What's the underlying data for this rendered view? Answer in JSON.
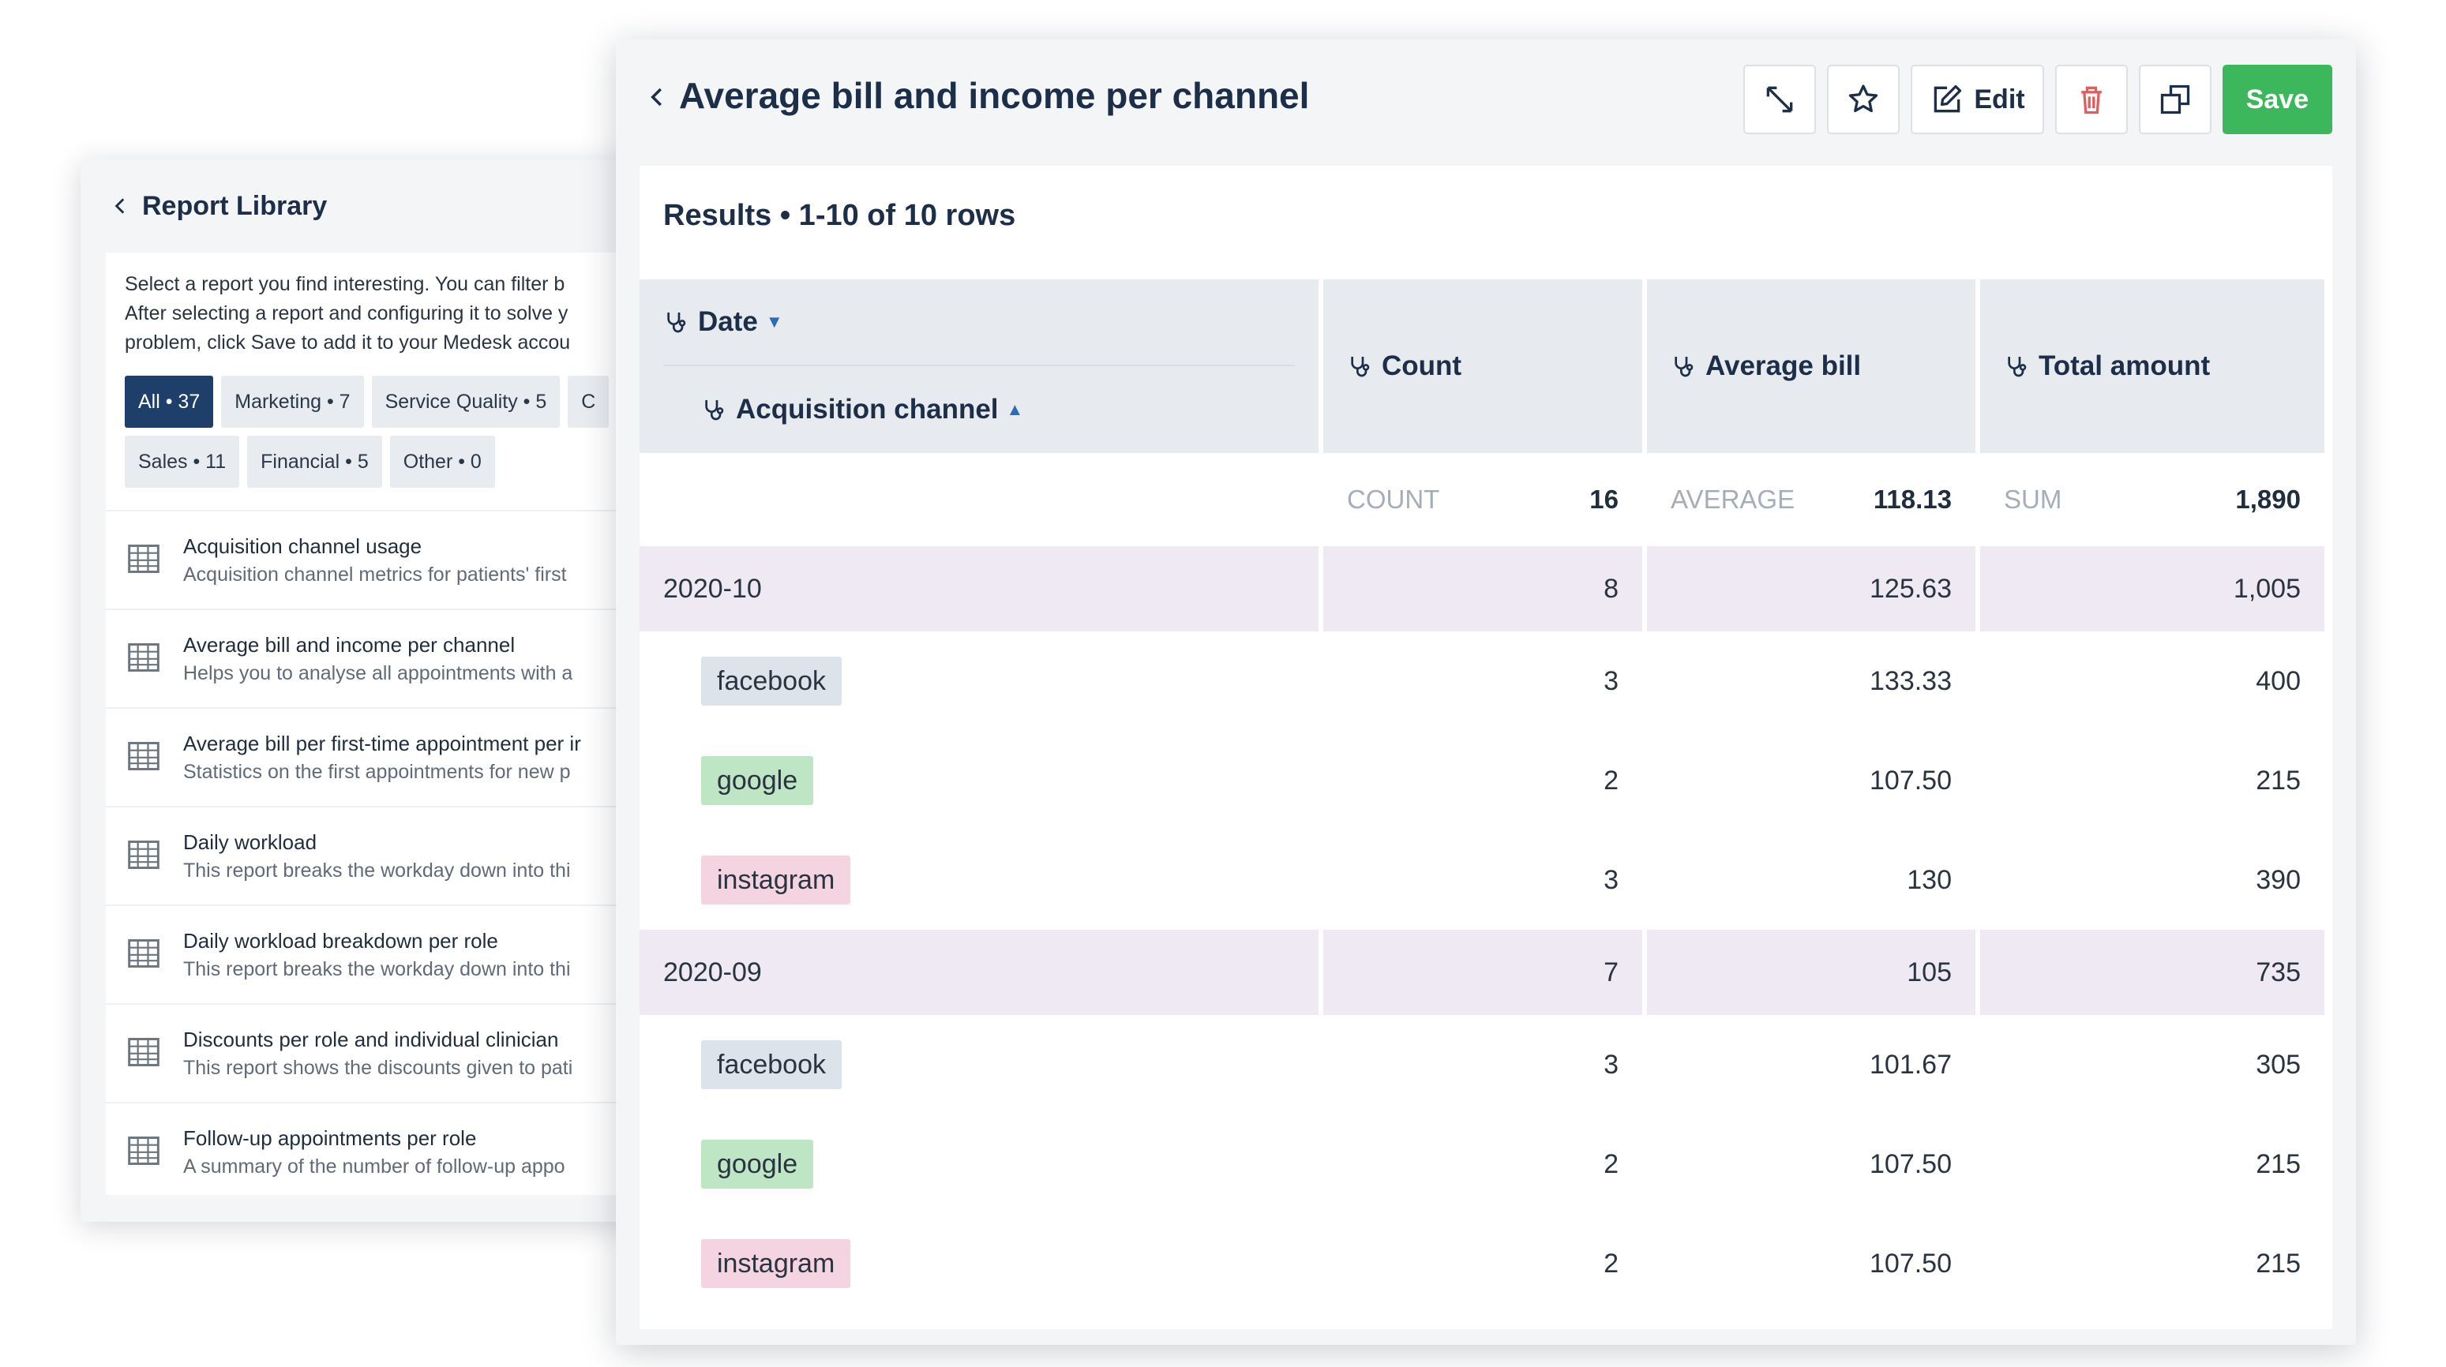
{
  "library": {
    "title": "Report Library",
    "desc_lines": [
      "Select a report you find interesting. You can filter b",
      "After selecting a report and configuring it to solve y",
      "problem, click Save to add it to your Medesk accou"
    ],
    "chips_row1": [
      {
        "label": "All • 37",
        "active": true
      },
      {
        "label": "Marketing • 7",
        "active": false
      },
      {
        "label": "Service Quality • 5",
        "active": false
      },
      {
        "label": "C",
        "active": false
      }
    ],
    "chips_row2": [
      {
        "label": "Sales • 11",
        "active": false
      },
      {
        "label": "Financial • 5",
        "active": false
      },
      {
        "label": "Other • 0",
        "active": false
      }
    ],
    "items": [
      {
        "title": "Acquisition channel usage",
        "desc": "Acquisition channel metrics for patients' first"
      },
      {
        "title": "Average bill and income per channel",
        "desc": "Helps you to analyse all appointments with a"
      },
      {
        "title": "Average bill per first-time appointment per ir",
        "desc": "Statistics on the first appointments for new p"
      },
      {
        "title": "Daily workload",
        "desc": "This report breaks the workday down into thi"
      },
      {
        "title": "Daily workload breakdown per role",
        "desc": "This report breaks the workday down into thi"
      },
      {
        "title": "Discounts per role and individual clinician",
        "desc": "This report shows the discounts given to pati"
      },
      {
        "title": "Follow-up appointments per role",
        "desc": "A summary of the number of follow-up appo"
      }
    ]
  },
  "report": {
    "title": "Average bill and income per channel",
    "toolbar": {
      "expand_icon": "expand-icon",
      "star_icon": "star-icon",
      "edit_label": "Edit",
      "delete_icon": "trash-icon",
      "copy_icon": "copy-icon",
      "save_label": "Save"
    },
    "results_title": "Results • 1-10 of 10 rows",
    "columns": {
      "date": "Date",
      "channel": "Acquisition channel",
      "count": "Count",
      "avg": "Average bill",
      "total": "Total amount"
    },
    "summary": {
      "count_label": "COUNT",
      "count_value": "16",
      "avg_label": "AVERAGE",
      "avg_value": "118.13",
      "total_label": "SUM",
      "total_value": "1,890"
    },
    "rows": [
      {
        "type": "group",
        "label": "2020-10",
        "count": "8",
        "avg": "125.63",
        "total": "1,005"
      },
      {
        "type": "sub",
        "label": "facebook",
        "tag": "facebook",
        "count": "3",
        "avg": "133.33",
        "total": "400"
      },
      {
        "type": "sub",
        "label": "google",
        "tag": "google",
        "count": "2",
        "avg": "107.50",
        "total": "215"
      },
      {
        "type": "sub",
        "label": "instagram",
        "tag": "instagram",
        "count": "3",
        "avg": "130",
        "total": "390"
      },
      {
        "type": "group",
        "label": "2020-09",
        "count": "7",
        "avg": "105",
        "total": "735"
      },
      {
        "type": "sub",
        "label": "facebook",
        "tag": "facebook",
        "count": "3",
        "avg": "101.67",
        "total": "305"
      },
      {
        "type": "sub",
        "label": "google",
        "tag": "google",
        "count": "2",
        "avg": "107.50",
        "total": "215"
      },
      {
        "type": "sub",
        "label": "instagram",
        "tag": "instagram",
        "count": "2",
        "avg": "107.50",
        "total": "215"
      }
    ],
    "colors": {
      "accent": "#3db75b",
      "header_bg": "#e7eaee",
      "group_row_bg": "#efe9f4",
      "facebook": "#dce3ea",
      "google": "#bfe6c4",
      "instagram": "#f4d4e1"
    }
  }
}
